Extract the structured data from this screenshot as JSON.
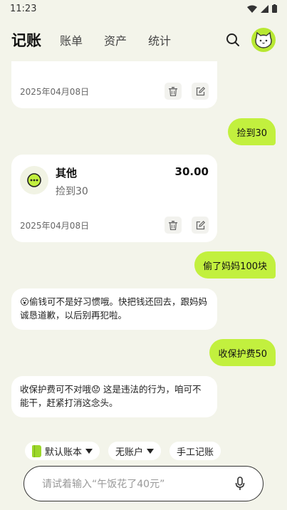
{
  "status_bar": {
    "time": "11:23"
  },
  "header": {
    "tabs": [
      {
        "label": "记账",
        "active": true
      },
      {
        "label": "账单",
        "active": false
      },
      {
        "label": "资产",
        "active": false
      },
      {
        "label": "统计",
        "active": false
      }
    ]
  },
  "messages": {
    "card1": {
      "date": "2025年04月08日"
    },
    "user1": {
      "text": "捡到30"
    },
    "card2": {
      "category": "其他",
      "note": "捡到30",
      "amount": "30.00",
      "date": "2025年04月08日"
    },
    "user2": {
      "text": "偷了妈妈100块"
    },
    "ai1": {
      "text": "😮偷钱可不是好习惯哦。快把钱还回去，跟妈妈诚恳道歉，以后别再犯啦。"
    },
    "user3": {
      "text": "收保护费50"
    },
    "ai2": {
      "text": "收保护费可不对哦😟 这是违法的行为，咱可不能干，赶紧打消这念头。"
    }
  },
  "quick_actions": {
    "ledger": "默认账本",
    "account": "无账户",
    "manual": "手工记账"
  },
  "input": {
    "placeholder": "请试着输入“午饭花了40元”"
  },
  "colors": {
    "accent": "#c2f03e",
    "background": "#f3f4ea"
  }
}
